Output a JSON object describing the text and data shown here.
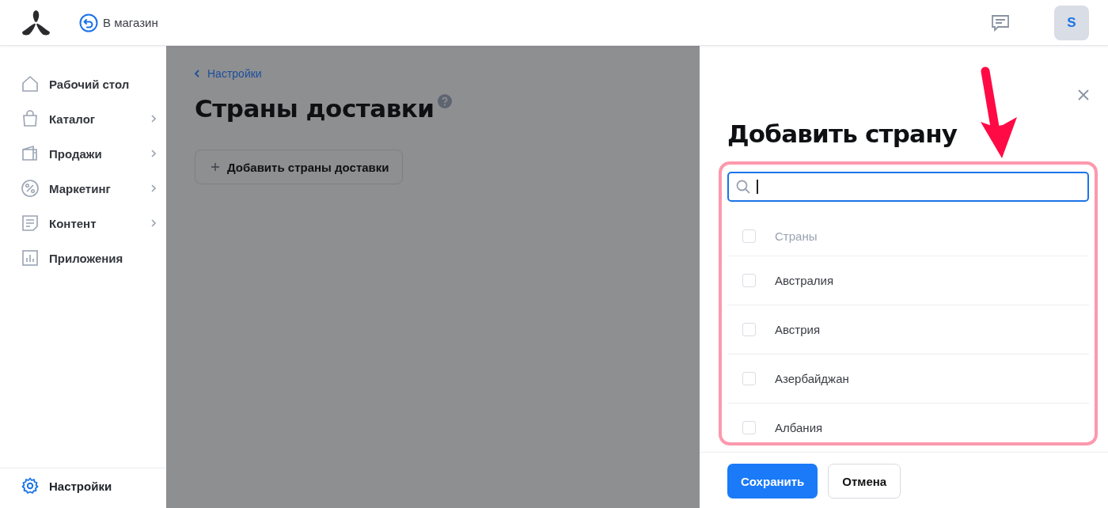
{
  "header": {
    "store_link": "В магазин",
    "avatar": "S"
  },
  "sidebar": {
    "items": [
      {
        "label": "Рабочий стол",
        "expandable": false,
        "selected": false
      },
      {
        "label": "Каталог",
        "expandable": true,
        "selected": false
      },
      {
        "label": "Продажи",
        "expandable": true,
        "selected": false
      },
      {
        "label": "Маркетинг",
        "expandable": true,
        "selected": false
      },
      {
        "label": "Контент",
        "expandable": true,
        "selected": false
      },
      {
        "label": "Приложения",
        "expandable": false,
        "selected": false
      }
    ],
    "footer_item": {
      "label": "Настройки",
      "selected": true
    }
  },
  "page": {
    "breadcrumb": "Настройки",
    "title": "Страны доставки",
    "add_button": "Добавить страны доставки"
  },
  "drawer": {
    "title": "Добавить страну",
    "search": {
      "focused": true
    },
    "list": [
      {
        "kind": "header",
        "label": "Страны",
        "checked": false
      },
      {
        "kind": "country",
        "label": "Австралия",
        "checked": false
      },
      {
        "kind": "country",
        "label": "Австрия",
        "checked": false
      },
      {
        "kind": "country",
        "label": "Азербайджан",
        "checked": false
      },
      {
        "kind": "country",
        "label": "Албания",
        "checked": false
      }
    ],
    "buttons": [
      {
        "label": "Сохранить",
        "kind": "primary"
      },
      {
        "label": "Отмена",
        "kind": "secondary"
      }
    ]
  }
}
